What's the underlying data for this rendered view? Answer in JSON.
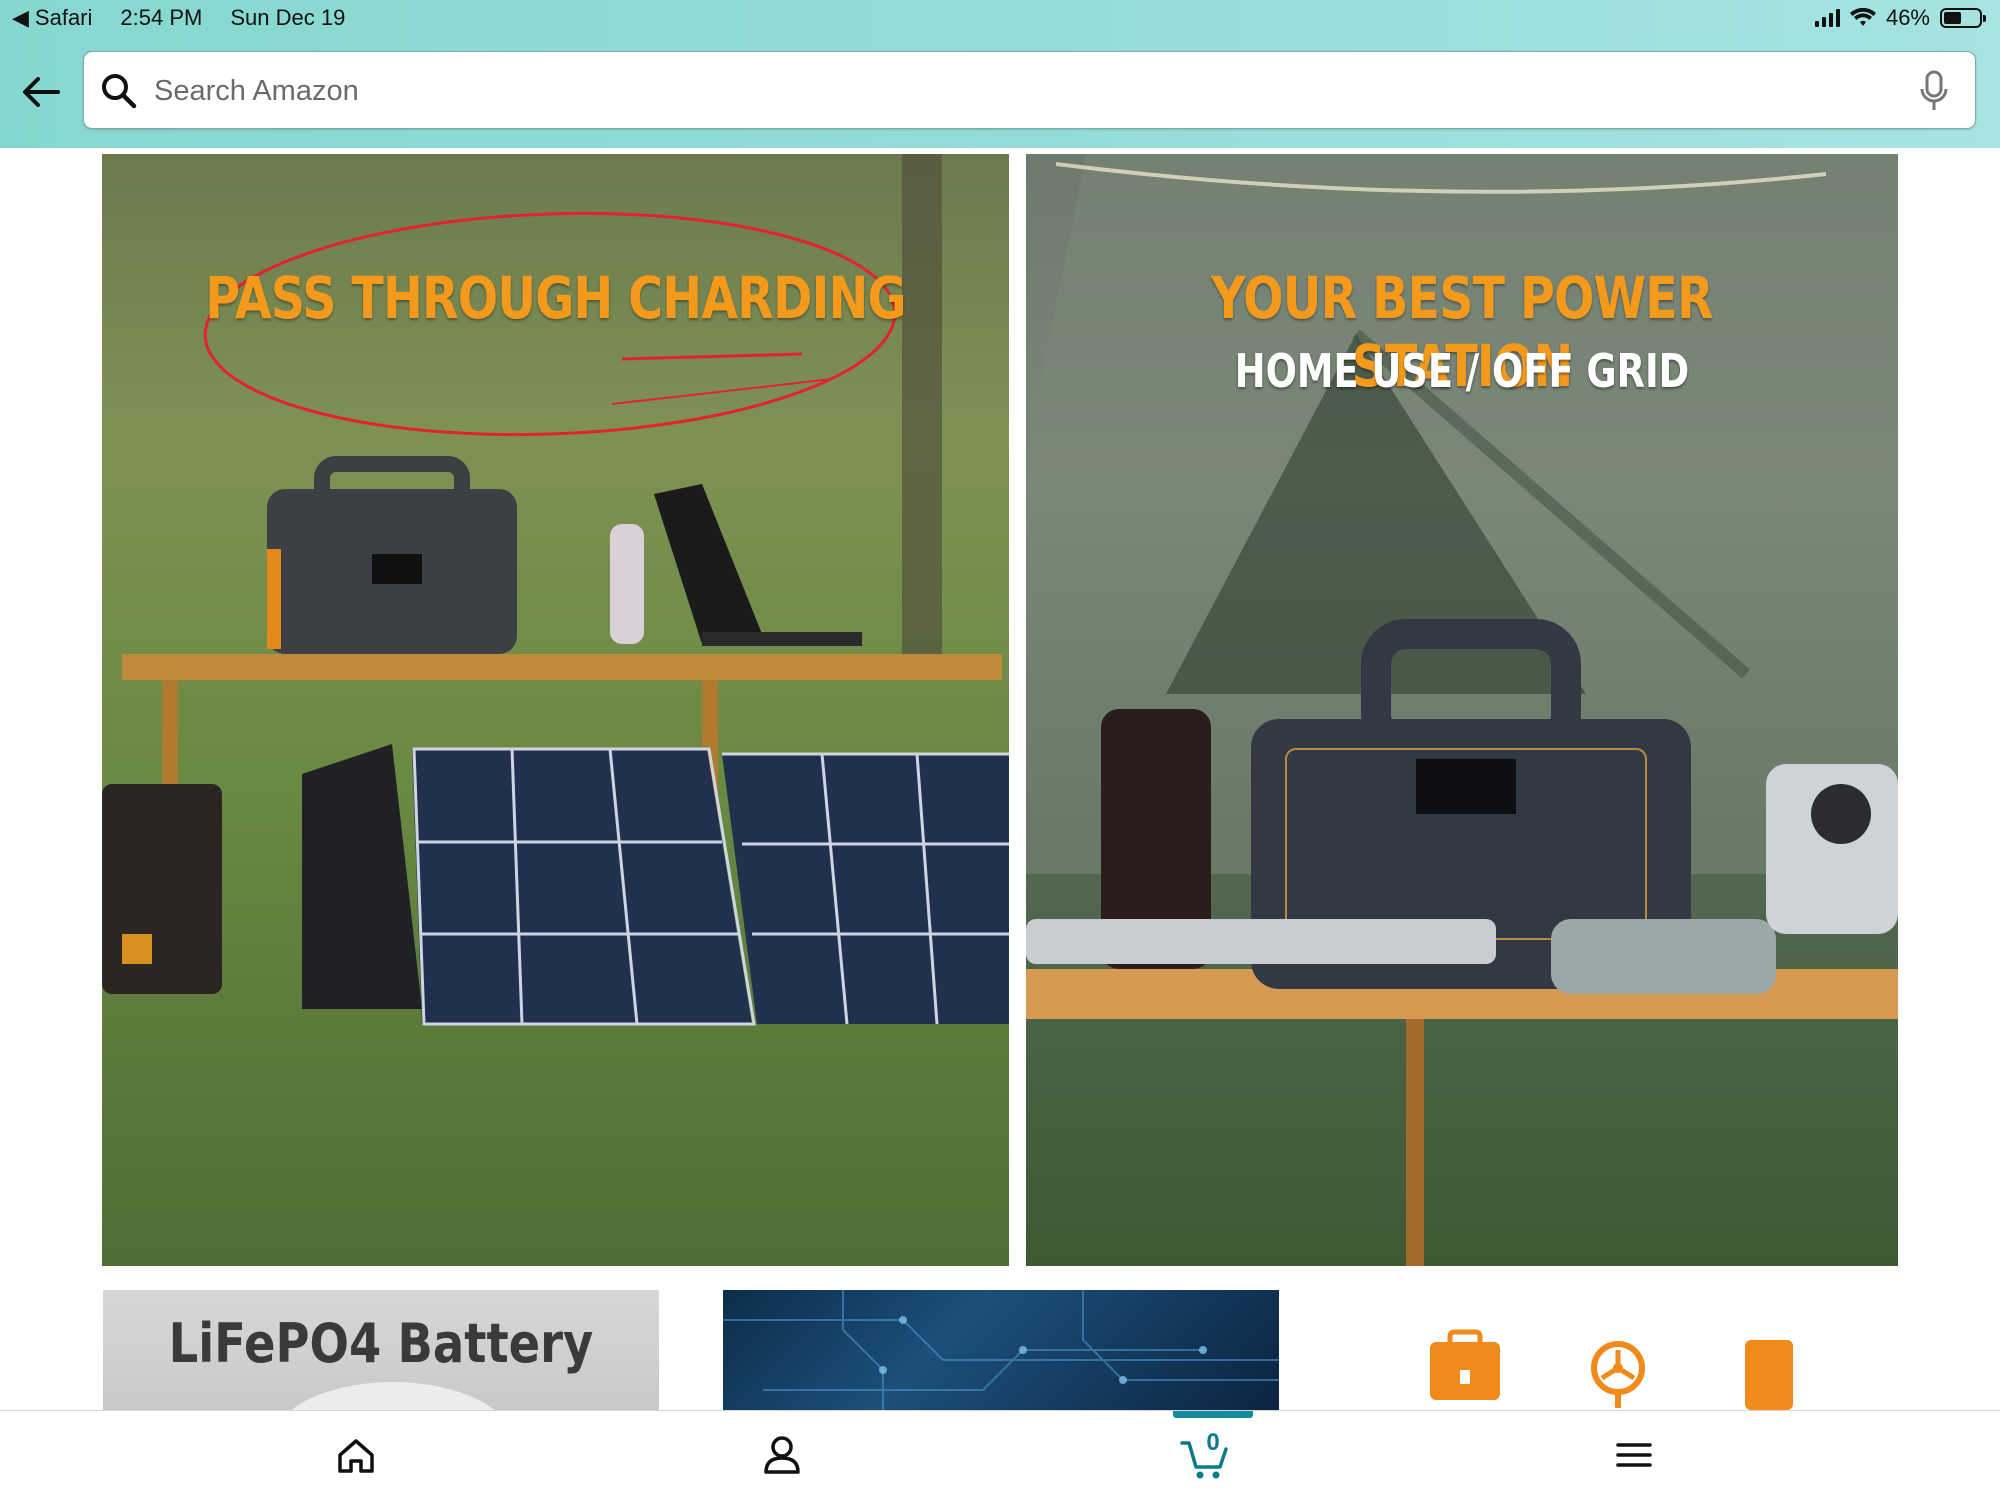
{
  "status_bar": {
    "app": "Safari",
    "time": "2:54 PM",
    "date": "Sun Dec 19",
    "battery": "46%"
  },
  "header": {
    "back_icon": "back-arrow-icon",
    "search": {
      "placeholder": "Search Amazon",
      "value": ""
    }
  },
  "hero": [
    {
      "headline": "PASS THROUGH CHARDING",
      "subtitle": ""
    },
    {
      "headline": "YOUR BEST POWER STATION",
      "subtitle": "HOME USE / OFF GRID"
    }
  ],
  "tiles": [
    {
      "label": "LiFePO4 Battery"
    },
    {
      "label": ""
    },
    {
      "label": ""
    }
  ],
  "bottom_nav": {
    "items": [
      "home-icon",
      "account-icon",
      "cart-icon",
      "menu-icon"
    ],
    "cart_count": "0"
  },
  "colors": {
    "accent": "#148b9a",
    "headline": "#f39a1d",
    "icon_orange": "#f08a1b"
  }
}
